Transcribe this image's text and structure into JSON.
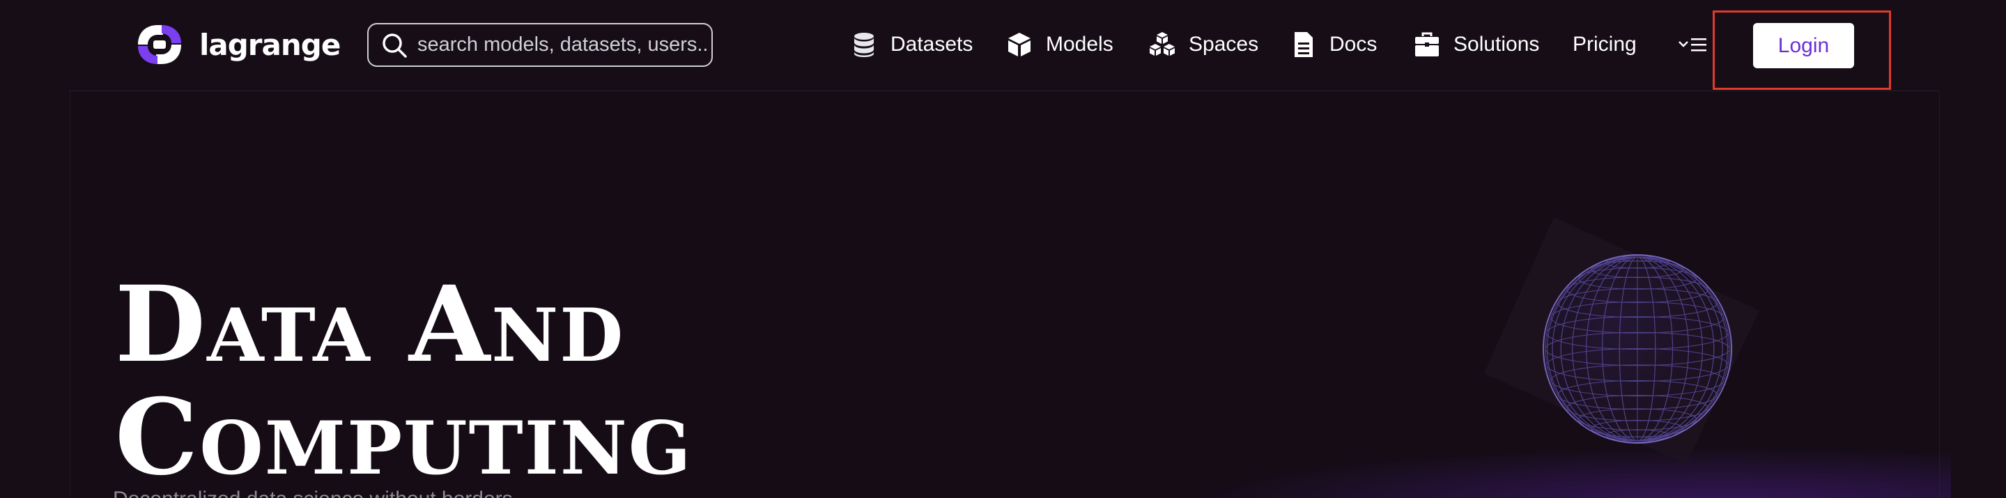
{
  "brand": {
    "name": "lagrange",
    "accent": "#6b2fd6",
    "background": "#160d17"
  },
  "search": {
    "placeholder": "search models, datasets, users..",
    "icon": "search-icon"
  },
  "nav": {
    "items": [
      {
        "label": "Datasets",
        "icon": "database-icon"
      },
      {
        "label": "Models",
        "icon": "cube-icon"
      },
      {
        "label": "Spaces",
        "icon": "cubes-icon"
      },
      {
        "label": "Docs",
        "icon": "document-icon"
      },
      {
        "label": "Solutions",
        "icon": "briefcase-icon"
      },
      {
        "label": "Pricing",
        "icon": ""
      }
    ],
    "menu_icon": "chevron-menu-icon",
    "login_label": "Login",
    "login_highlight_color": "#e23b2a"
  },
  "hero": {
    "title_line1": "Data And",
    "title_line2": "Computing",
    "subtitle": "Decentralized data science without borders"
  }
}
